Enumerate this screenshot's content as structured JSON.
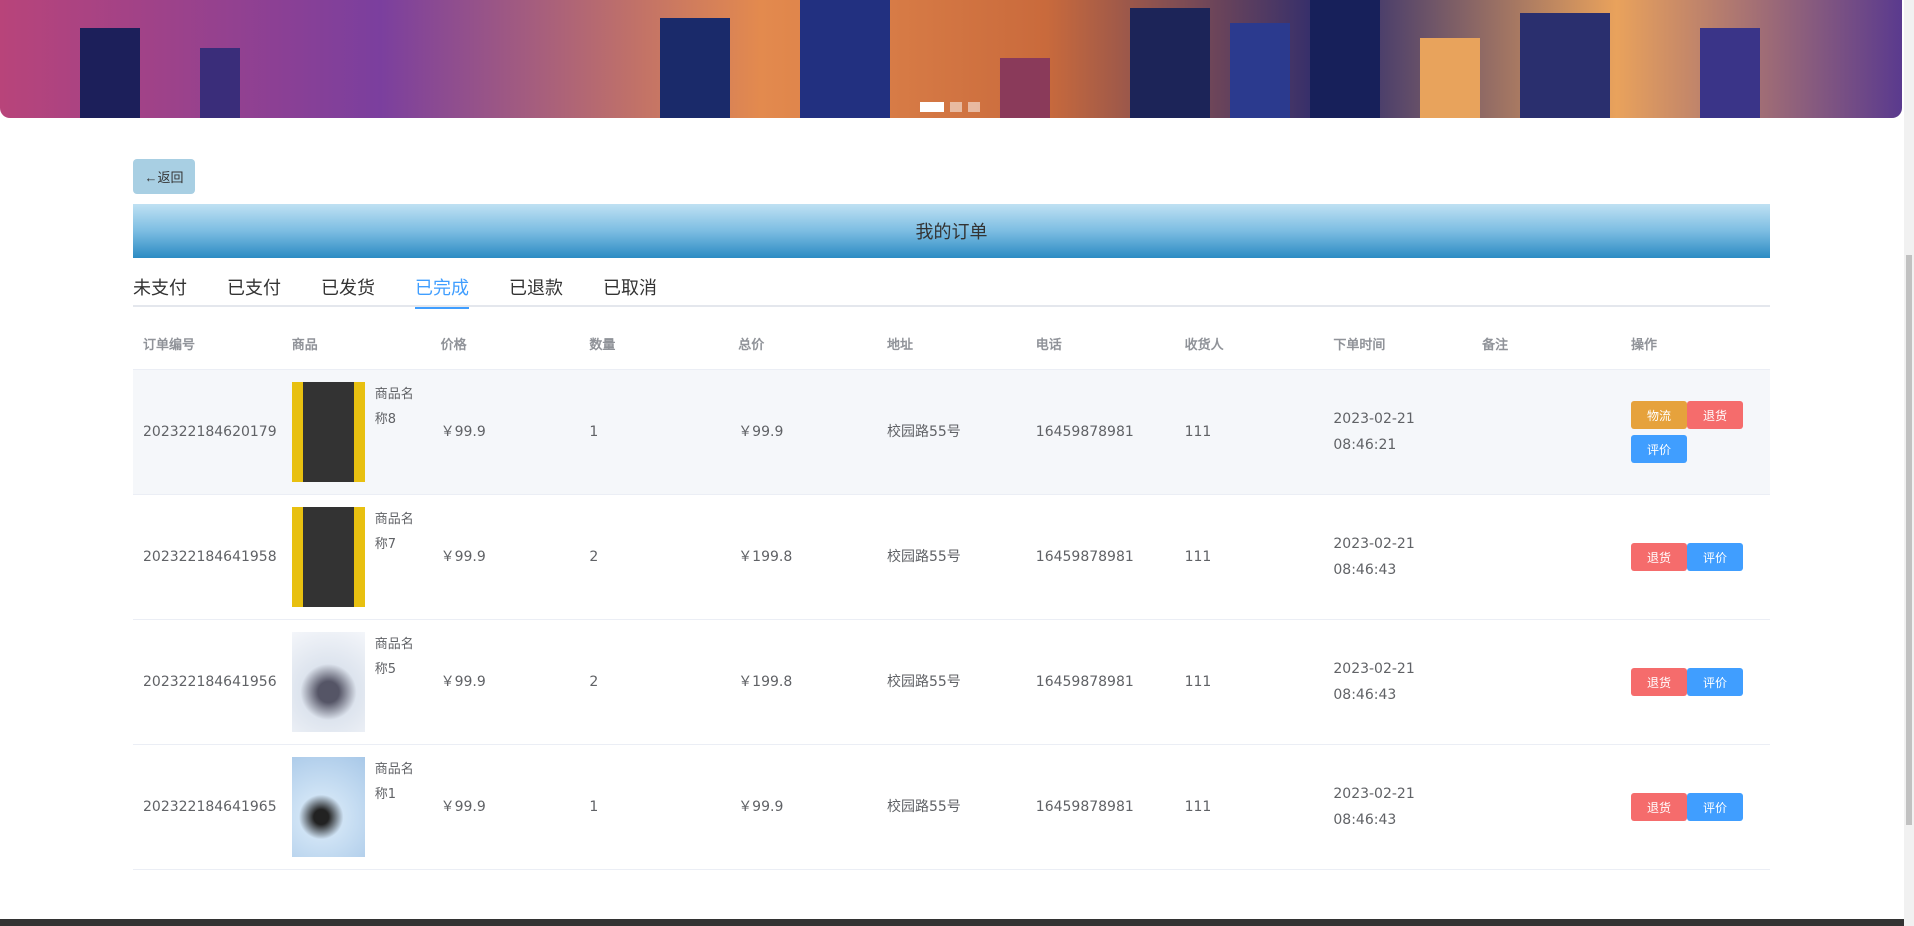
{
  "back_label": "←返回",
  "page_title": "我的订单",
  "tabs": [
    "未支付",
    "已支付",
    "已发货",
    "已完成",
    "已退款",
    "已取消"
  ],
  "active_tab": "已完成",
  "columns": [
    "订单编号",
    "商品",
    "价格",
    "数量",
    "总价",
    "地址",
    "电话",
    "收货人",
    "下单时间",
    "备注",
    "操作"
  ],
  "orders": [
    {
      "id": "202322184620179",
      "name": "商品名称8",
      "price": "￥99.9",
      "qty": "1",
      "total": "￥99.9",
      "addr": "校园路55号",
      "phone": "16459878981",
      "receiver": "111",
      "time": "2023-02-21 08:46:21",
      "note": "",
      "actions": [
        "物流",
        "退货",
        "评价"
      ]
    },
    {
      "id": "202322184641958",
      "name": "商品名称7",
      "price": "￥99.9",
      "qty": "2",
      "total": "￥199.8",
      "addr": "校园路55号",
      "phone": "16459878981",
      "receiver": "111",
      "time": "2023-02-21 08:46:43",
      "note": "",
      "actions": [
        "退货",
        "评价"
      ]
    },
    {
      "id": "202322184641956",
      "name": "商品名称5",
      "price": "￥99.9",
      "qty": "2",
      "total": "￥199.8",
      "addr": "校园路55号",
      "phone": "16459878981",
      "receiver": "111",
      "time": "2023-02-21 08:46:43",
      "note": "",
      "actions": [
        "退货",
        "评价"
      ]
    },
    {
      "id": "202322184641965",
      "name": "商品名称1",
      "price": "￥99.9",
      "qty": "1",
      "total": "￥99.9",
      "addr": "校园路55号",
      "phone": "16459878981",
      "receiver": "111",
      "time": "2023-02-21 08:46:43",
      "note": "",
      "actions": [
        "退货",
        "评价"
      ]
    }
  ],
  "colors": {
    "primary": "#409eff",
    "danger": "#f56c6c",
    "warning": "#e6a23c"
  }
}
